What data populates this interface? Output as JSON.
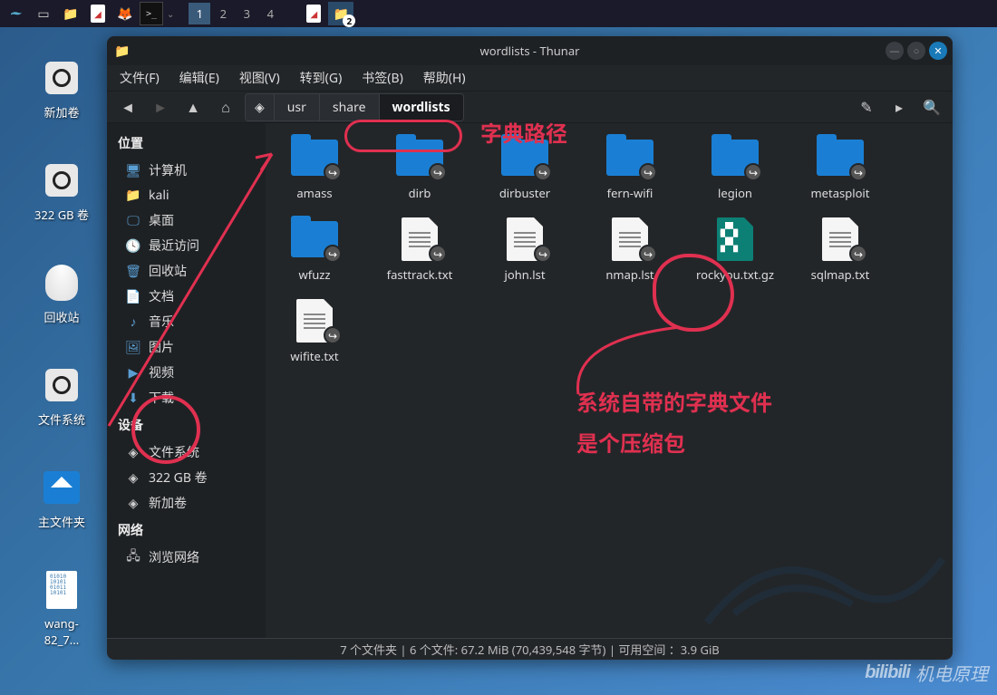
{
  "taskbar": {
    "workspaces": [
      "1",
      "2",
      "3",
      "4"
    ],
    "badge": "2"
  },
  "desktop": {
    "icons": [
      {
        "label": "新加卷",
        "kind": "volume"
      },
      {
        "label": "322 GB 卷",
        "kind": "volume"
      },
      {
        "label": "回收站",
        "kind": "trash"
      },
      {
        "label": "文件系统",
        "kind": "volume"
      },
      {
        "label": "主文件夹",
        "kind": "home"
      },
      {
        "label": "wang-82_7...",
        "kind": "document"
      }
    ]
  },
  "thunar": {
    "title": "wordlists - Thunar",
    "menus": [
      "文件(F)",
      "编辑(E)",
      "视图(V)",
      "转到(G)",
      "书签(B)",
      "帮助(H)"
    ],
    "path": [
      "usr",
      "share",
      "wordlists"
    ],
    "sidebar": {
      "sections": [
        {
          "heading": "位置",
          "items": [
            {
              "label": "计算机",
              "icon": "computer",
              "color": "#5a9fd4"
            },
            {
              "label": "kali",
              "icon": "folder",
              "color": "#5a9fd4"
            },
            {
              "label": "桌面",
              "icon": "desktop",
              "color": "#5a9fd4"
            },
            {
              "label": "最近访问",
              "icon": "clock",
              "color": "#ccc"
            },
            {
              "label": "回收站",
              "icon": "trash",
              "color": "#5a9fd4"
            },
            {
              "label": "文档",
              "icon": "doc",
              "color": "#5a9fd4"
            },
            {
              "label": "音乐",
              "icon": "music",
              "color": "#5a9fd4"
            },
            {
              "label": "图片",
              "icon": "image",
              "color": "#5a9fd4"
            },
            {
              "label": "视频",
              "icon": "video",
              "color": "#5a9fd4"
            },
            {
              "label": "下载",
              "icon": "download",
              "color": "#5a9fd4"
            }
          ]
        },
        {
          "heading": "设备",
          "items": [
            {
              "label": "文件系统",
              "icon": "disk",
              "color": "#ccc"
            },
            {
              "label": "322 GB 卷",
              "icon": "disk",
              "color": "#ccc"
            },
            {
              "label": "新加卷",
              "icon": "disk",
              "color": "#ccc"
            }
          ]
        },
        {
          "heading": "网络",
          "items": [
            {
              "label": "浏览网络",
              "icon": "network",
              "color": "#ccc"
            }
          ]
        }
      ]
    },
    "files": [
      {
        "name": "amass",
        "type": "folder-link"
      },
      {
        "name": "dirb",
        "type": "folder-link"
      },
      {
        "name": "dirbuster",
        "type": "folder-link"
      },
      {
        "name": "fern-wifi",
        "type": "folder-link"
      },
      {
        "name": "legion",
        "type": "folder-link"
      },
      {
        "name": "metasploit",
        "type": "folder-link"
      },
      {
        "name": "wfuzz",
        "type": "folder-link"
      },
      {
        "name": "fasttrack.txt",
        "type": "text-link"
      },
      {
        "name": "john.lst",
        "type": "text-link"
      },
      {
        "name": "nmap.lst",
        "type": "text-link"
      },
      {
        "name": "rockyou.txt.gz",
        "type": "archive"
      },
      {
        "name": "sqlmap.txt",
        "type": "text-link"
      },
      {
        "name": "wifite.txt",
        "type": "text-link"
      }
    ],
    "status": "7 个文件夹 | 6 个文件: 67.2 MiB (70,439,548 字节) | 可用空间 ：3.9 GiB"
  },
  "annotations": {
    "path_label": "字典路径",
    "note1": "系统自带的字典文件",
    "note2": "是个压缩包"
  },
  "watermark": {
    "logo": "bilibili",
    "text": "机电原理"
  }
}
